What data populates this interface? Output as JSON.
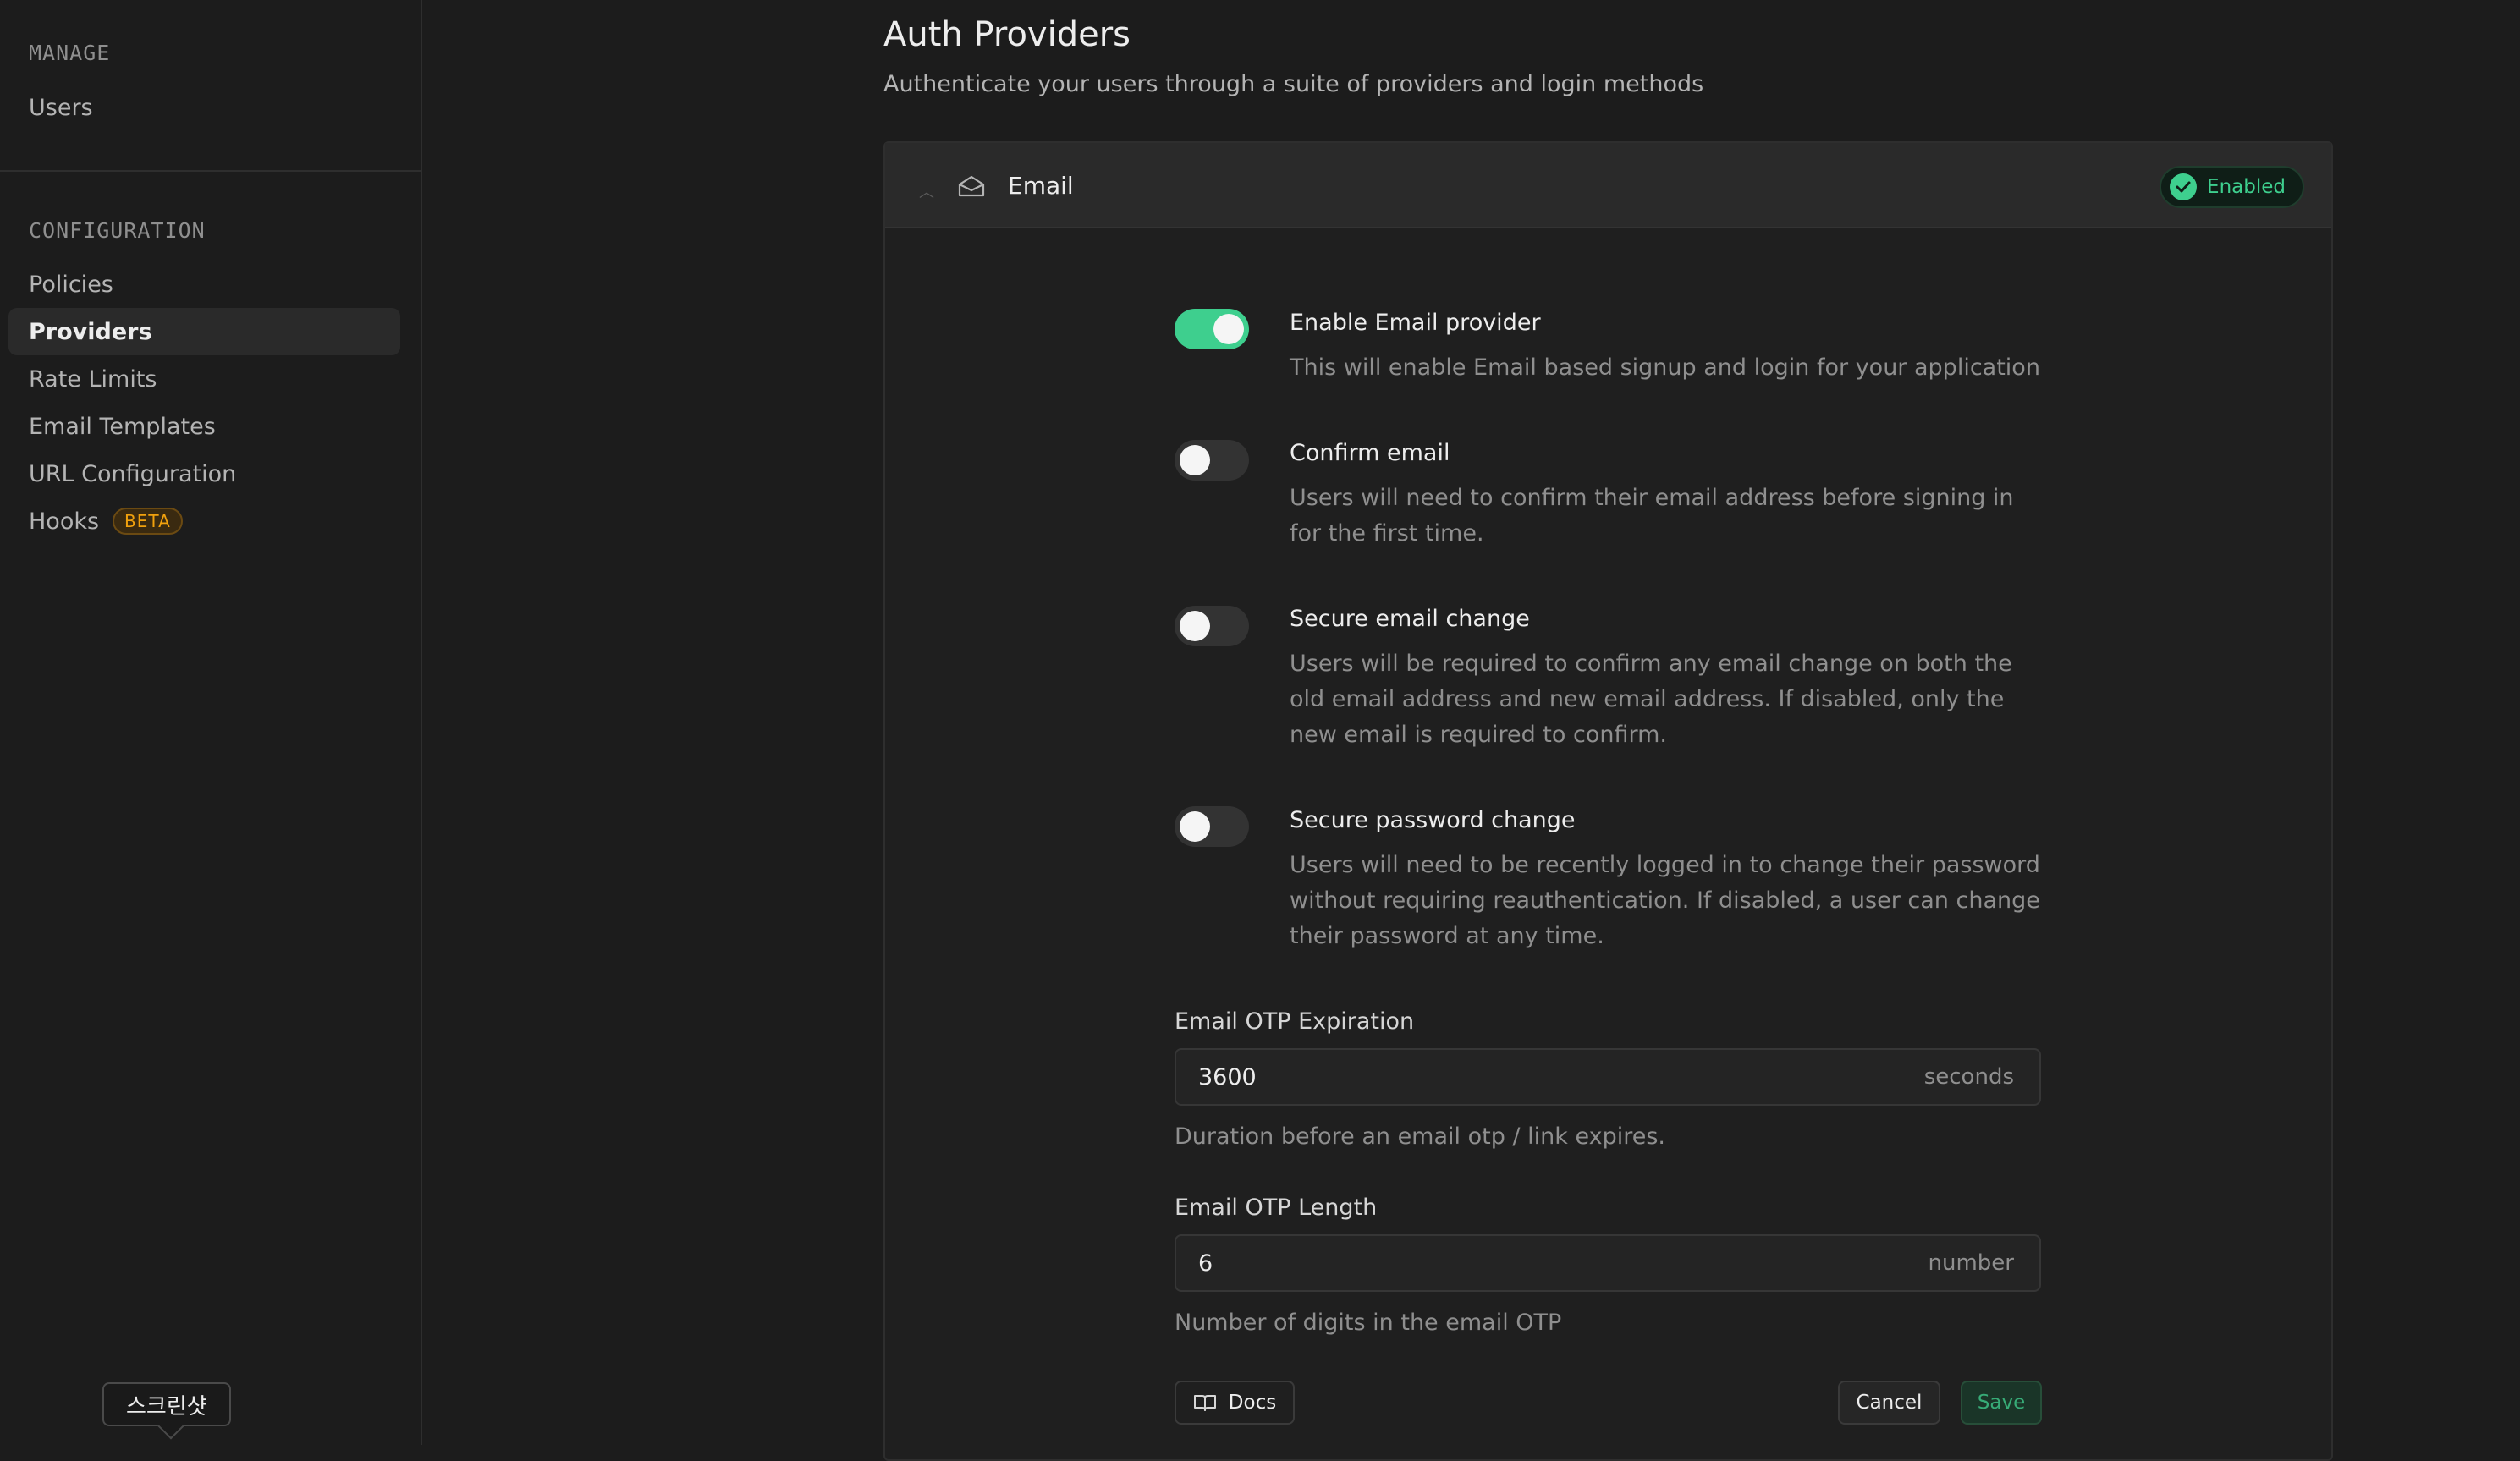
{
  "sidebar": {
    "manage_title": "MANAGE",
    "manage_items": [
      {
        "label": "Users"
      }
    ],
    "config_title": "CONFIGURATION",
    "config_items": [
      {
        "label": "Policies"
      },
      {
        "label": "Providers",
        "active": true
      },
      {
        "label": "Rate Limits"
      },
      {
        "label": "Email Templates"
      },
      {
        "label": "URL Configuration"
      },
      {
        "label": "Hooks",
        "badge": "BETA"
      }
    ],
    "tooltip": "스크린샷"
  },
  "main": {
    "title": "Auth Providers",
    "subtitle": "Authenticate your users through a suite of providers and login methods",
    "provider": {
      "name": "Email",
      "icon": "mail-open-icon",
      "status": "Enabled",
      "options": [
        {
          "title": "Enable Email provider",
          "desc": "This will enable Email based signup and login for your application",
          "on": true
        },
        {
          "title": "Confirm email",
          "desc": "Users will need to confirm their email address before signing in for the first time.",
          "on": false
        },
        {
          "title": "Secure email change",
          "desc": "Users will be required to confirm any email change on both the old email address and new email address. If disabled, only the new email is required to confirm.",
          "on": false
        },
        {
          "title": "Secure password change",
          "desc": "Users will need to be recently logged in to change their password without requiring reauthentication. If disabled, a user can change their password at any time.",
          "on": false
        }
      ],
      "fields": [
        {
          "label": "Email OTP Expiration",
          "value": "3600",
          "suffix": "seconds",
          "help": "Duration before an email otp / link expires."
        },
        {
          "label": "Email OTP Length",
          "value": "6",
          "suffix": "number",
          "help": "Number of digits in the email OTP"
        }
      ],
      "buttons": {
        "docs": "Docs",
        "cancel": "Cancel",
        "save": "Save"
      }
    }
  },
  "colors": {
    "accent": "#3ecf8e",
    "beta": "#f1a10d"
  }
}
